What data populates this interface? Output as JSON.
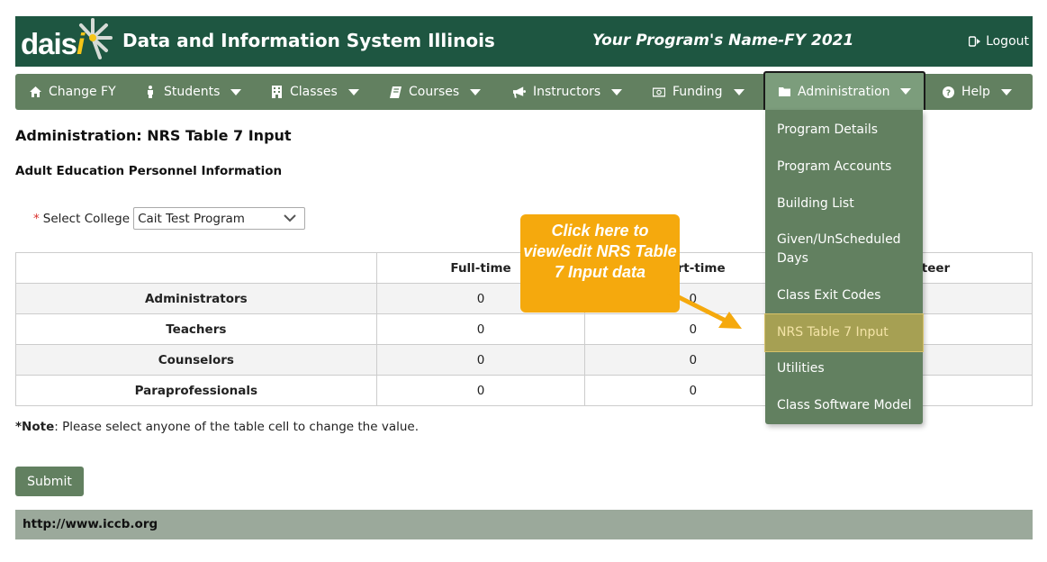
{
  "header": {
    "logo_text": "dais",
    "logo_accent": "i",
    "site_title": "Data and Information System Illinois",
    "program_name": "Your Program's Name-FY 2021",
    "logout_label": "Logout"
  },
  "nav": {
    "items": [
      {
        "label": "Change FY",
        "icon": "home-icon",
        "has_caret": false
      },
      {
        "label": "Students",
        "icon": "person-icon",
        "has_caret": true
      },
      {
        "label": "Classes",
        "icon": "building-icon",
        "has_caret": true
      },
      {
        "label": "Courses",
        "icon": "book-icon",
        "has_caret": true
      },
      {
        "label": "Instructors",
        "icon": "bullhorn-icon",
        "has_caret": true
      },
      {
        "label": "Funding",
        "icon": "money-icon",
        "has_caret": true
      },
      {
        "label": "Administration",
        "icon": "folder-icon",
        "has_caret": true,
        "active": true
      },
      {
        "label": "Help",
        "icon": "question-icon",
        "has_caret": true
      }
    ]
  },
  "admin_menu": {
    "items": [
      {
        "label": "Program Details"
      },
      {
        "label": "Program Accounts"
      },
      {
        "label": "Building List"
      },
      {
        "label": "Given/UnScheduled Days"
      },
      {
        "label": "Class Exit Codes"
      },
      {
        "label": "NRS Table 7 Input",
        "highlighted": true
      },
      {
        "label": "Utilities"
      },
      {
        "label": "Class Software Model"
      }
    ]
  },
  "page": {
    "title": "Administration: NRS Table 7 Input",
    "section_title": "Adult Education Personnel Information",
    "select_required_mark": "*",
    "select_label": "Select College",
    "select_value": "Cait Test Program"
  },
  "table": {
    "columns": [
      "",
      "Full-time",
      "Part-time",
      "Volunteer"
    ],
    "rows": [
      {
        "label": "Administrators",
        "full_time": "0",
        "part_time": "0",
        "volunteer": ""
      },
      {
        "label": "Teachers",
        "full_time": "0",
        "part_time": "0",
        "volunteer": ""
      },
      {
        "label": "Counselors",
        "full_time": "0",
        "part_time": "0",
        "volunteer": ""
      },
      {
        "label": "Paraprofessionals",
        "full_time": "0",
        "part_time": "0",
        "volunteer": ""
      }
    ]
  },
  "note": {
    "label": "*Note",
    "text": ": Please select anyone of the table cell to change the value."
  },
  "submit_label": "Submit",
  "footer_link": "http://www.iccb.org",
  "callout": {
    "text": "Click here to view/edit NRS Table 7 Input data"
  },
  "colors": {
    "header_bg": "#1e5641",
    "nav_bg": "#628060",
    "callout_bg": "#f5a90d",
    "highlight_bg": "#a6a053",
    "footer_bg": "#9ba99b"
  }
}
